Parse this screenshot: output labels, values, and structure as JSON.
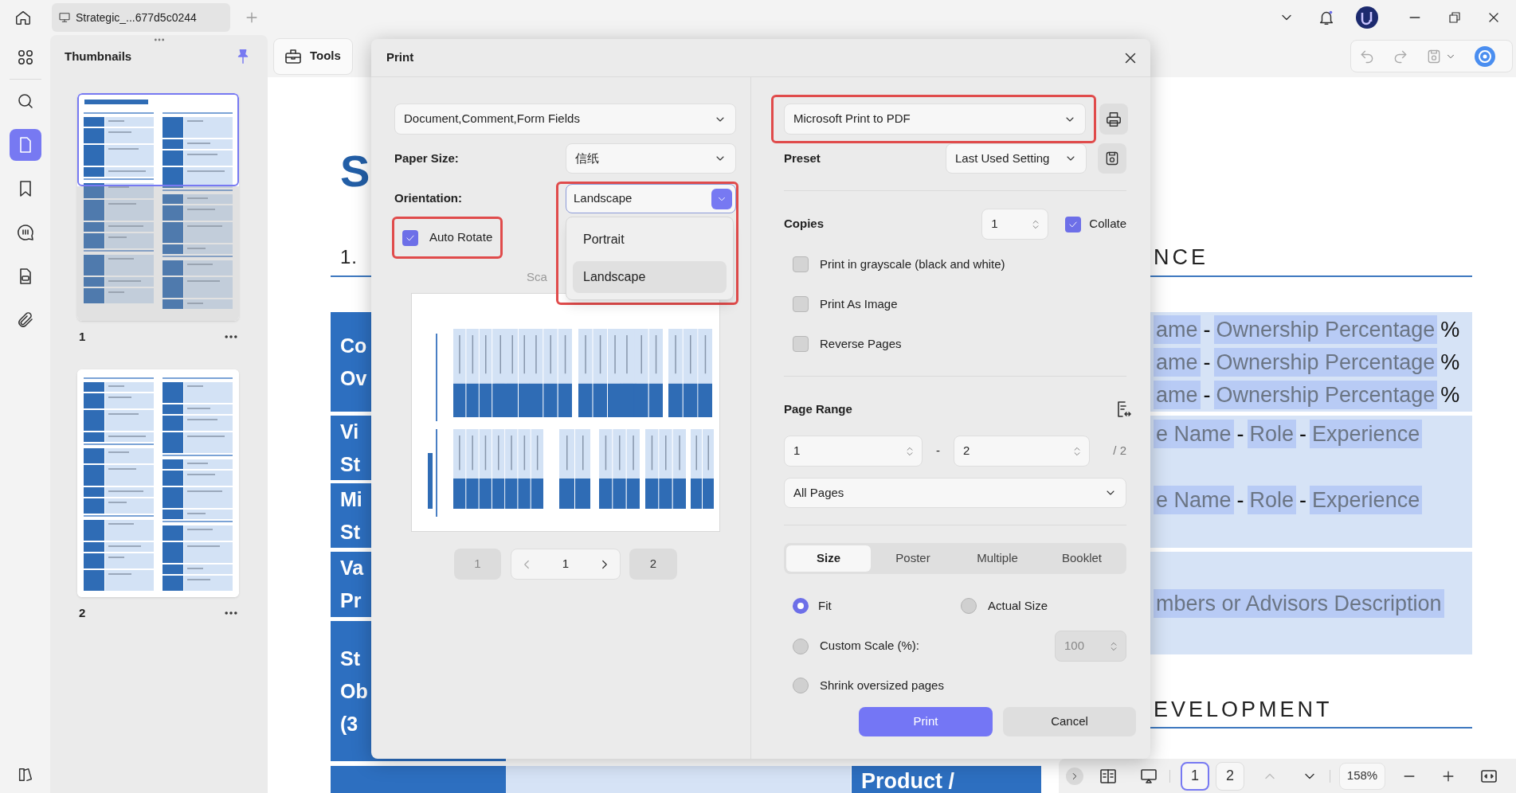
{
  "app": {
    "tab_title": "Strategic_...677d5c0244"
  },
  "rail_items": [
    {
      "kind": "apps",
      "selected": false
    },
    {
      "kind": "search",
      "selected": false
    },
    {
      "kind": "pages",
      "selected": true
    },
    {
      "kind": "bookmarks",
      "selected": false
    },
    {
      "kind": "comments",
      "selected": false
    },
    {
      "kind": "forms",
      "selected": false
    },
    {
      "kind": "attachments",
      "selected": false
    }
  ],
  "thumbnails": {
    "title": "Thumbnails",
    "pages": [
      {
        "label": "1",
        "selected": true
      },
      {
        "label": "2",
        "selected": false
      }
    ]
  },
  "toolbar": {
    "tools_label": "Tools"
  },
  "document": {
    "title_fragment": "S",
    "section_fragment": "1.",
    "left_cells": [
      [
        "Co",
        "Ov"
      ],
      [
        "Vi",
        "St"
      ],
      [
        "Mi",
        "St"
      ],
      [
        "Va",
        "Pr"
      ],
      [
        "St",
        "Ob",
        "(3"
      ]
    ],
    "right_heading": "NCE",
    "right_blocks": [
      {
        "lines": [
          [
            {
              "text": "ame",
              "highlighted": true
            },
            {
              "text": "-",
              "highlighted": false
            },
            {
              "text": "Ownership Percentage",
              "highlighted": true
            },
            {
              "text": "%",
              "highlighted": false
            }
          ],
          [
            {
              "text": "ame",
              "highlighted": true
            },
            {
              "text": "-",
              "highlighted": false
            },
            {
              "text": "Ownership Percentage",
              "highlighted": true
            },
            {
              "text": "%",
              "highlighted": false
            }
          ],
          [
            {
              "text": "ame",
              "highlighted": true
            },
            {
              "text": "-",
              "highlighted": false
            },
            {
              "text": "Ownership Percentage",
              "highlighted": true
            },
            {
              "text": "%",
              "highlighted": false
            }
          ]
        ]
      },
      {
        "lines": [
          [
            {
              "text": "e Name",
              "highlighted": true
            },
            {
              "text": "-",
              "highlighted": false
            },
            {
              "text": "Role",
              "highlighted": true
            },
            {
              "text": "-",
              "highlighted": false
            },
            {
              "text": "Experience",
              "highlighted": true
            }
          ],
          [
            {
              "text": "e Name",
              "highlighted": true
            },
            {
              "text": "-",
              "highlighted": false
            },
            {
              "text": "Role",
              "highlighted": true
            },
            {
              "text": "-",
              "highlighted": false
            },
            {
              "text": "Experience",
              "highlighted": true
            }
          ]
        ]
      },
      {
        "lines": [
          [
            {
              "text": "mbers or Advisors Description",
              "highlighted": true
            }
          ]
        ]
      }
    ],
    "second_heading": "EVELOPMENT",
    "bottom_cell": "Product /"
  },
  "print_dialog": {
    "title": "Print",
    "content_select": {
      "value": "Document,Comment,Form Fields"
    },
    "paper_size": {
      "label": "Paper Size:",
      "value": "信纸"
    },
    "orientation": {
      "label": "Orientation:",
      "value": "Landscape",
      "expanded": true,
      "annotated": true,
      "options": [
        {
          "label": "Portrait",
          "selected": false
        },
        {
          "label": "Landscape",
          "selected": true
        }
      ]
    },
    "auto_rotate": {
      "label": "Auto Rotate",
      "checked": true,
      "annotated": true
    },
    "scale_label": "Sca",
    "preview_pager": {
      "first": "1",
      "current": "1",
      "last": "2"
    },
    "printer": {
      "value": "Microsoft Print to PDF",
      "annotated": true
    },
    "preset": {
      "label": "Preset",
      "value": "Last Used Setting"
    },
    "copies": {
      "label": "Copies",
      "value": "1",
      "collate": {
        "label": "Collate",
        "checked": true
      }
    },
    "options": [
      {
        "label": "Print in grayscale (black and white)",
        "checked": false
      },
      {
        "label": "Print As Image",
        "checked": false
      },
      {
        "label": "Reverse Pages",
        "checked": false
      }
    ],
    "page_range": {
      "label": "Page Range",
      "from": "1",
      "separator": "-",
      "to": "2",
      "total": "/ 2",
      "mode": "All Pages"
    },
    "layout_tabs": [
      {
        "label": "Size",
        "selected": true
      },
      {
        "label": "Poster",
        "selected": false
      },
      {
        "label": "Multiple",
        "selected": false
      },
      {
        "label": "Booklet",
        "selected": false
      }
    ],
    "scaling": [
      {
        "label": "Fit",
        "selected": true
      },
      {
        "label": "Actual Size",
        "selected": false
      },
      {
        "label": "Custom Scale (%):",
        "selected": false
      },
      {
        "label": "Shrink oversized pages",
        "selected": false
      }
    ],
    "custom_scale": {
      "value": "100",
      "disabled": true
    },
    "buttons": [
      {
        "label": "Print",
        "kind": "primary"
      },
      {
        "label": "Cancel",
        "kind": "secondary"
      }
    ]
  },
  "bottom_bar": {
    "pages": [
      {
        "label": "1",
        "selected": true
      },
      {
        "label": "2",
        "selected": false
      }
    ],
    "zoom": "158%"
  }
}
